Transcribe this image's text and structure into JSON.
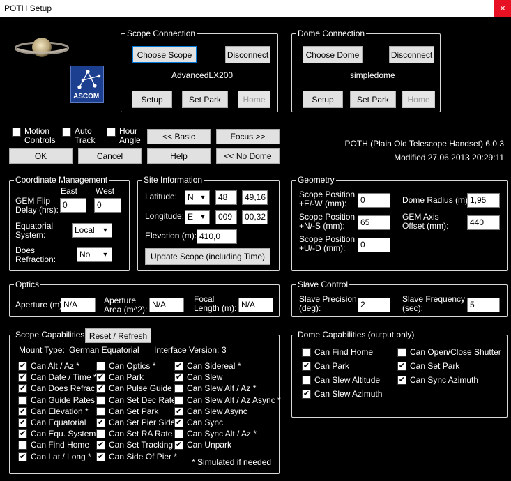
{
  "window": {
    "title": "POTH Setup",
    "close_glyph": "×"
  },
  "scope_connection": {
    "title": "Scope Connection",
    "choose_label": "Choose Scope",
    "disconnect_label": "Disconnect",
    "device_name": "AdvancedLX200",
    "setup_label": "Setup",
    "set_park_label": "Set Park",
    "home_label": "Home"
  },
  "dome_connection": {
    "title": "Dome Connection",
    "choose_label": "Choose Dome",
    "disconnect_label": "Disconnect",
    "device_name": "simpledome",
    "setup_label": "Setup",
    "set_park_label": "Set Park",
    "home_label": "Home"
  },
  "logo": {
    "text": "ASCOM"
  },
  "options": {
    "motion_controls": {
      "line1": "Motion",
      "line2": "Controls",
      "checked": false
    },
    "auto_track": {
      "line1": "Auto",
      "line2": "Track",
      "checked": false
    },
    "hour_angle": {
      "line1": "Hour",
      "line2": "Angle",
      "checked": false
    }
  },
  "buttons": {
    "basic": "<< Basic",
    "focus": "Focus >>",
    "ok": "OK",
    "cancel": "Cancel",
    "help": "Help",
    "no_dome": "<< No Dome"
  },
  "version": {
    "name": "POTH (Plain Old Telescope Handset) 6.0.3",
    "modified": "Modified 27.06.2013 20:29:11"
  },
  "coordinate_management": {
    "title": "Coordinate Management",
    "east_label": "East",
    "west_label": "West",
    "gem_flip_label_1": "GEM Flip",
    "gem_flip_label_2": "Delay (hrs):",
    "east_value": "0",
    "west_value": "0",
    "equatorial_label_1": "Equatorial",
    "equatorial_label_2": "System:",
    "equatorial_value": "Local",
    "refraction_label_1": "Does",
    "refraction_label_2": "Refraction:",
    "refraction_value": "No"
  },
  "site_information": {
    "title": "Site Information",
    "latitude_label": "Latitude:",
    "latitude_hemi": "N",
    "latitude_deg": "48",
    "latitude_min": "49,16",
    "longitude_label": "Longitude:",
    "longitude_hemi": "E",
    "longitude_deg": "009",
    "longitude_min": "00,32",
    "elevation_label": "Elevation (m):",
    "elevation_value": "410,0",
    "update_label": "Update Scope (including Time)"
  },
  "geometry": {
    "title": "Geometry",
    "ew_label_1": "Scope Position",
    "ew_label_2": "+E/-W (mm):",
    "ew_value": "0",
    "ns_label_1": "Scope Position",
    "ns_label_2": "+N/-S (mm):",
    "ns_value": "65",
    "ud_label_1": "Scope Position",
    "ud_label_2": "+U/-D (mm):",
    "ud_value": "0",
    "dome_radius_label": "Dome Radius (m):",
    "dome_radius_value": "1,95",
    "gem_offset_label_1": "GEM Axis",
    "gem_offset_label_2": "Offset (mm):",
    "gem_offset_value": "440"
  },
  "optics": {
    "title": "Optics",
    "aperture_label": "Aperture (m):",
    "aperture_value": "N/A",
    "area_label_1": "Aperture",
    "area_label_2": "Area (m^2):",
    "area_value": "N/A",
    "focal_label_1": "Focal",
    "focal_label_2": "Length (m):",
    "focal_value": "N/A"
  },
  "slave_control": {
    "title": "Slave Control",
    "precision_label_1": "Slave Precision",
    "precision_label_2": "(deg):",
    "precision_value": "2",
    "frequency_label_1": "Slave Frequency",
    "frequency_label_2": "(sec):",
    "frequency_value": "5"
  },
  "scope_capabilities": {
    "title": "Scope Capabilities",
    "reset_label": "Reset / Refresh",
    "mount_type_label": "Mount Type:",
    "mount_type_value": "German Equatorial",
    "interface_label": "Interface Version:",
    "interface_value": "3",
    "footnote": "* Simulated if needed",
    "columns": [
      [
        {
          "label": "Can Alt / Az *",
          "checked": true
        },
        {
          "label": "Can Date / Time *",
          "checked": true
        },
        {
          "label": "Can Does Refrac *",
          "checked": true
        },
        {
          "label": "Can Guide Rates",
          "checked": false
        },
        {
          "label": "Can Elevation *",
          "checked": true
        },
        {
          "label": "Can Equatorial",
          "checked": true
        },
        {
          "label": "Can Equ. System *",
          "checked": true
        },
        {
          "label": "Can Find Home",
          "checked": false
        },
        {
          "label": "Can Lat / Long *",
          "checked": true
        }
      ],
      [
        {
          "label": "Can Optics *",
          "checked": false
        },
        {
          "label": "Can Park",
          "checked": true
        },
        {
          "label": "Can Pulse Guide",
          "checked": true
        },
        {
          "label": "Can Set Dec Rate",
          "checked": false
        },
        {
          "label": "Can Set Park",
          "checked": false
        },
        {
          "label": "Can Set Pier Side",
          "checked": true
        },
        {
          "label": "Can Set RA Rate",
          "checked": false
        },
        {
          "label": "Can Set Tracking",
          "checked": true
        },
        {
          "label": "Can Side Of Pier *",
          "checked": true
        }
      ],
      [
        {
          "label": "Can Sidereal *",
          "checked": true
        },
        {
          "label": "Can Slew",
          "checked": true
        },
        {
          "label": "Can Slew Alt / Az *",
          "checked": false
        },
        {
          "label": "Can Slew Alt / Az Async *",
          "checked": false
        },
        {
          "label": "Can Slew Async",
          "checked": true
        },
        {
          "label": "Can Sync",
          "checked": true
        },
        {
          "label": "Can Sync Alt / Az *",
          "checked": false
        },
        {
          "label": "Can Unpark",
          "checked": true
        }
      ]
    ]
  },
  "dome_capabilities": {
    "title": "Dome Capabilities  (output only)",
    "columns": [
      [
        {
          "label": "Can Find Home",
          "checked": false
        },
        {
          "label": "Can Park",
          "checked": true
        },
        {
          "label": "Can Slew Altitude",
          "checked": false
        },
        {
          "label": "Can Slew Azimuth",
          "checked": true
        }
      ],
      [
        {
          "label": "Can Open/Close Shutter",
          "checked": false
        },
        {
          "label": "Can Set Park",
          "checked": true
        },
        {
          "label": "Can Sync Azimuth",
          "checked": true
        }
      ]
    ]
  },
  "check_glyph": "✔",
  "dropdown_glyph": "▼"
}
